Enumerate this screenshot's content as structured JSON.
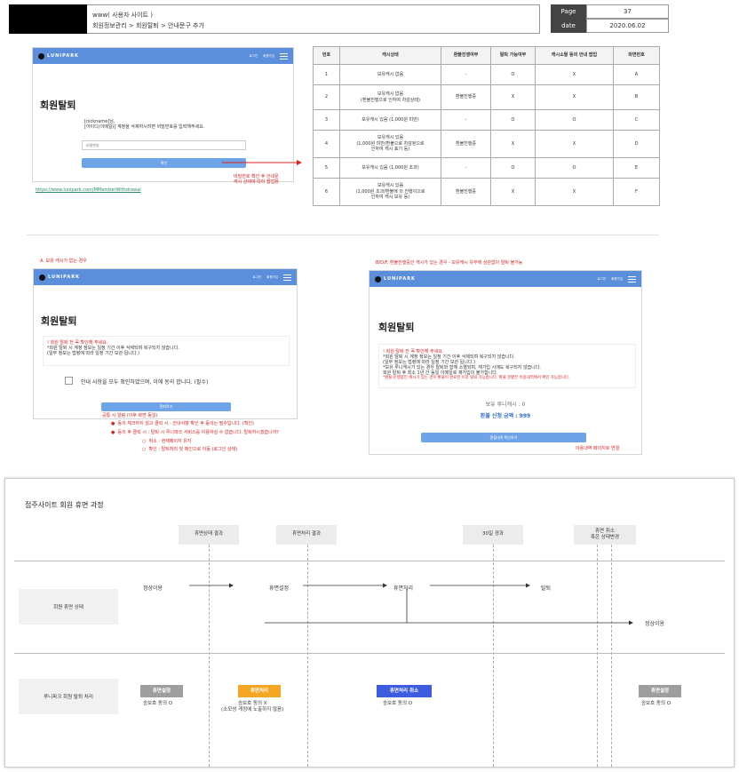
{
  "header": {
    "site": "www( 사용자 사이트 )",
    "breadcrumb": "회원정보관리 > 회원탈퇴 > 안내문구 추가",
    "page_label": "Page",
    "page_value": "37",
    "date_label": "date",
    "date_value": "2020.06.02"
  },
  "mock_top": {
    "brand": "LUNIPARK",
    "nav1": "로그인",
    "nav2": "회원가입",
    "title": "회원탈퇴",
    "line1": "[nickname]님,",
    "line2": "[아이디(이메일)] 계정을 삭제하시려면 비밀번호를 입력해주세요.",
    "password_placeholder": "비밀번호",
    "confirm": "확인",
    "url": "https://www.lunipark.com/MMemberWithdrawal",
    "note1": "비밀번호 확인 후 안내문",
    "note2": "캐시 상태에 따라 팝업창"
  },
  "table": {
    "headers": [
      "번호",
      "캐시상태",
      "환불진행여부",
      "탈퇴 가능여부",
      "캐시소멸 동의 안내 팝업",
      "화면번호"
    ],
    "rows": [
      [
        "1",
        "보유캐시 없음",
        "-",
        "O",
        "X",
        "A"
      ],
      [
        "2",
        "보유캐시 없음\n(환불진행으로 인하여 차감상태)",
        "환불진행중",
        "X",
        "X",
        "B"
      ],
      [
        "3",
        "보유캐시 있음 (1,000원 미만)",
        "-",
        "O",
        "O",
        "C"
      ],
      [
        "4",
        "보유캐시 있음\n(1,000원 미만/환불으로 차감된으로\n인하여 캐시 표기 등)",
        "환불진행중",
        "X",
        "X",
        "D"
      ],
      [
        "5",
        "보유캐시 있음 (1,000원 초과)",
        "-",
        "O",
        "O",
        "E"
      ],
      [
        "6",
        "보유캐시 있음\n(1,000원 초과/환불에 의 진행이으로\n인하여 캐시 보유 등)",
        "환불진행중",
        "X",
        "X",
        "F"
      ]
    ]
  },
  "mock_a": {
    "caption": "A. 보유 캐시가 없는 경우",
    "title": "회원탈퇴",
    "notice1": "! 회원 탈퇴 전 꼭 확인해 주세요.",
    "notice2": "*회원 탈퇴 시 계정 정보는 일정 기간 이후 삭제되며 복구되지 않습니다.",
    "notice3": "(일부 정보는 법령에 따라 일정 기간 보관 됩니다.)",
    "agree": "안내 사항을 모두 확인하였으며, 이에 동의 합니다. (필수)",
    "button": "탈퇴하기",
    "b1": "공통 시 알림 (이후 화면 동일)",
    "b2": "동의 체크하지 않고 클릭 시 : 안내사항 확인 후 동의는 필수입니다. (확인)",
    "b3": "동의 후 클릭 시 : 탈퇴 시 루니파크 서비스를 이용하실 수 없습니다. 탈퇴하시겠습니까?",
    "b4": "취소 : 현재페이지 유지",
    "b5": "확인 : 탈퇴처리 및 메인으로 이동 (로그인 상태)"
  },
  "mock_b": {
    "caption": "B/D/F. 환불진행중인 캐시가 있는 경우 - 보유캐시 유무에 상관없이 탈퇴 불가능",
    "title": "회원탈퇴",
    "n1": "! 회원 탈퇴 전 꼭 확인해 주세요.",
    "n2": "*회원 탈퇴 시 계정 정보는 일정 기간 이후 삭제되며 복구되지 않습니다.",
    "n3": "(일부 정보는 법령에 따라 일정 기간 보관 됩니다.)",
    "n4": "*보유 루니캐시가 있는 경우 탈퇴와 함께 소멸되며, 재가입 시에도 복구되지 않습니다.",
    "n5": "회원 탈퇴 후 최소 1년 간 동일 이메일로 재가입이 불가합니다.",
    "n6": "*환불 진행중인 캐시가 있는 경우 환불이 완료된 이후 탈퇴 가능합니다. 환불 현황은 이용내역에서 확인 가능합니다.",
    "cash": "보유 루니캐시 : 0",
    "refund": "환불 신청 금액 : 999",
    "button": "환불내역 확인하기",
    "note": "이용내역 페이지로 연결"
  },
  "flow": {
    "title": "접주사이트 회원 휴면 과정",
    "phase1": "휴면상태 결과",
    "phase2": "휴면처리 결과",
    "phase3": "30일 경과",
    "phase4a": "휴면 취소",
    "phase4b": "혹은 상태변경",
    "row1": "회원 휴면 상태",
    "row2": "루니파크 회원 탈퇴 처리",
    "s_normal": "정상이용",
    "s_sleep": "휴면설정",
    "s_proc": "휴면처리",
    "s_withdraw": "탈퇴",
    "s_back": "정상이용",
    "b1": "휴면설정",
    "b2": "휴면처리",
    "b3": "휴면처리 취소",
    "b4": "휴면설정",
    "c1": "승보호 동의 O",
    "c2a": "승보호 동의 X",
    "c2b": "(소모성 게정에 노출하지 않음)",
    "c3": "승보호 동의 O",
    "c4": "승보호 동의 O",
    "colors": {
      "gray": "#9e9e9e",
      "orange": "#f5a623",
      "blue": "#3d5ce0"
    }
  }
}
